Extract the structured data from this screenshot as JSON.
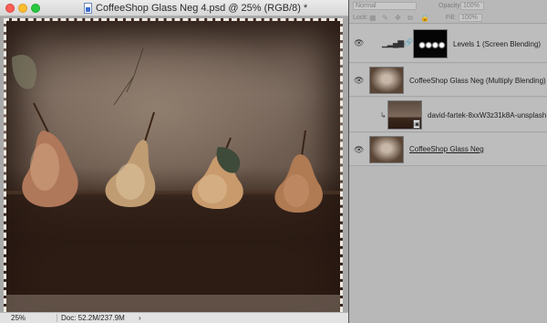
{
  "window": {
    "title": "CoffeeShop Glass Neg 4.psd @ 25% (RGB/8) *"
  },
  "statusbar": {
    "zoom": "25%",
    "doc_info": "Doc: 52.2M/237.9M",
    "arrow": "›"
  },
  "options": {
    "blend_mode": "Normal",
    "opacity_label": "Opacity:",
    "opacity_value": "100%",
    "lock_label": "Lock:",
    "fill_label": "Fill:",
    "fill_value": "100%"
  },
  "layers": [
    {
      "name": "Levels 1 (Screen Blending)",
      "type": "adjustment",
      "visible": true
    },
    {
      "name": "CoffeeShop Glass Neg (Multiply Blending)",
      "type": "image",
      "visible": true
    },
    {
      "name": "david-fartek-8xxW3z31k8A-unsplash",
      "type": "smart-object",
      "visible": false,
      "clipped": true
    },
    {
      "name": "CoffeeShop Glass Neg",
      "type": "image",
      "visible": true
    }
  ],
  "icons": {
    "eye": "eye-icon",
    "chain": "link-icon",
    "levels": "levels-histogram-icon",
    "document": "psd-document-icon"
  },
  "colors": {
    "panel_bg": "#b8b8b8",
    "close": "#fc5f57",
    "minimize": "#fdbc2e",
    "maximize": "#28c840"
  }
}
